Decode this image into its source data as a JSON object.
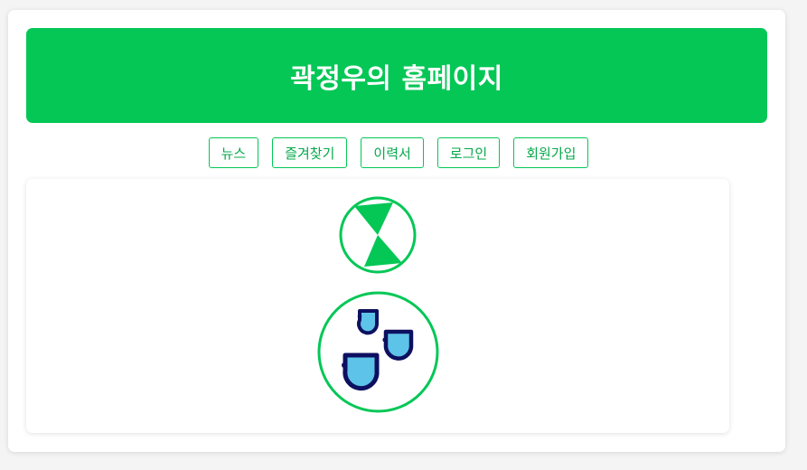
{
  "header": {
    "title": "곽정우의 홈페이지"
  },
  "nav": {
    "items": [
      {
        "label": "뉴스"
      },
      {
        "label": "즐겨찾기"
      },
      {
        "label": "이력서"
      },
      {
        "label": "로그인"
      },
      {
        "label": "회원가입"
      }
    ]
  },
  "content": {
    "icons": [
      "hourglass-icon",
      "water-drops-icon"
    ]
  },
  "colors": {
    "accent": "#04c756",
    "drop_fill": "#5ec3e8",
    "drop_outline": "#0d1060",
    "background": "#f4f4f4"
  }
}
